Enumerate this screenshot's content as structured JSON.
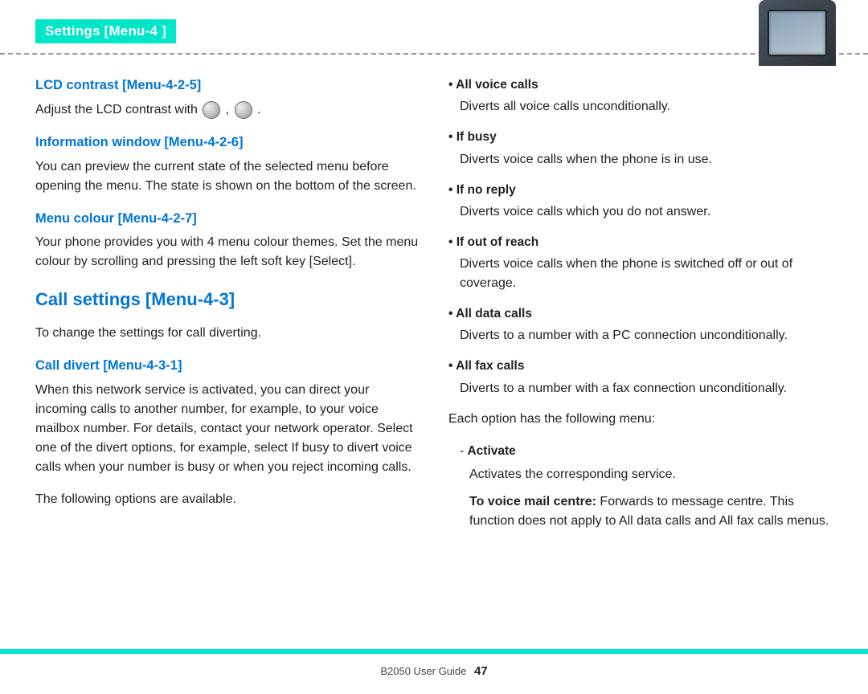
{
  "header": {
    "tab_label": "Settings [Menu-4 ]"
  },
  "left": {
    "h1": "LCD contrast [Menu-4-2-5]",
    "p1a": "Adjust the LCD contrast with ",
    "p1b": " , ",
    "p1c": " .",
    "h2": "Information window [Menu-4-2-6]",
    "p2": "You can preview the current state of the selected menu before opening the menu. The state is shown on the bottom of the screen.",
    "h3": "Menu colour [Menu-4-2-7]",
    "p3": "Your phone provides you with 4 menu colour themes. Set the menu colour by scrolling and pressing the left soft key [Select].",
    "h4": "Call settings [Menu-4-3]",
    "p4": "To change the settings for call diverting.",
    "h5": "Call divert [Menu-4-3-1]",
    "p5": "When this network service is activated, you can direct your incoming calls to another number, for example, to your voice mailbox number. For details, contact your network operator. Select one of the divert options, for example, select If busy to divert voice calls when your number is busy or when you reject incoming calls.",
    "p6": "The following options are available."
  },
  "right": {
    "items": [
      {
        "head": "All voice calls",
        "body": "Diverts all voice calls unconditionally."
      },
      {
        "head": "If busy",
        "body": "Diverts voice calls when the phone is in use."
      },
      {
        "head": "If no reply",
        "body": "Diverts voice calls which you do not answer."
      },
      {
        "head": "If out of reach",
        "body": "Diverts voice calls when the phone is switched off or out of coverage."
      },
      {
        "head": "All data calls",
        "body": "Diverts to a number with a PC connection unconditionally."
      },
      {
        "head": "All fax calls",
        "body": "Diverts to a number with a fax connection unconditionally."
      }
    ],
    "each_option": "Each option has the following menu:",
    "activate_label": "Activate",
    "activate_body": "Activates the corresponding service.",
    "tvmc_bold": "To voice mail centre: ",
    "tvmc_rest": "Forwards to message centre. This function does not apply to All data calls and All fax calls menus."
  },
  "footer": {
    "guide": "B2050 User Guide",
    "page": "47"
  }
}
